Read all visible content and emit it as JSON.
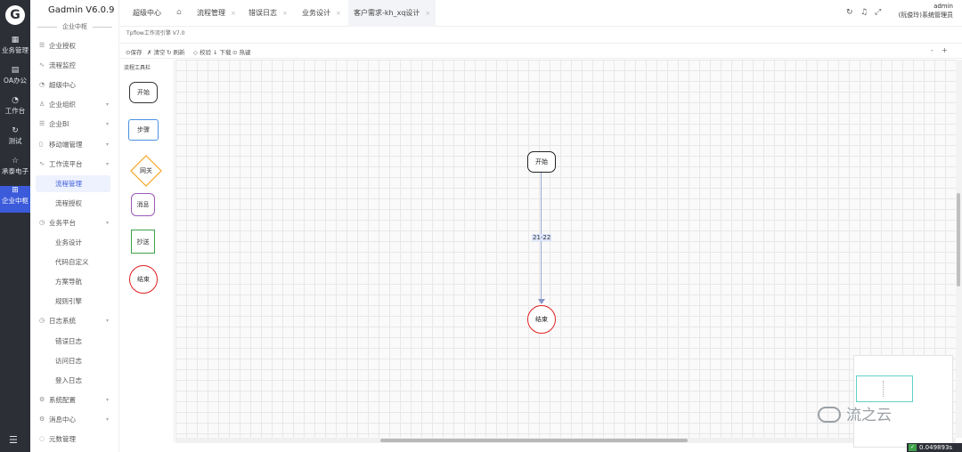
{
  "rail": {
    "logo": "G",
    "items": [
      {
        "icon": "grid-icon",
        "glyph": "▦",
        "label": "业务管理"
      },
      {
        "icon": "building-icon",
        "glyph": "▤",
        "label": "OA办公"
      },
      {
        "icon": "dashboard-icon",
        "glyph": "◔",
        "label": "工作台"
      },
      {
        "icon": "refresh-icon",
        "glyph": "↻",
        "label": "测试"
      },
      {
        "icon": "star-icon",
        "glyph": "☆",
        "label": "承泰电子"
      },
      {
        "icon": "apps-icon",
        "glyph": "⊞",
        "label": "企业中枢"
      }
    ],
    "menu_glyph": "☰"
  },
  "sidebar": {
    "brand": "Gadmin V6.0.9",
    "section": "企业中枢",
    "items": [
      {
        "glyph": "☰",
        "label": "企业授权",
        "chevron": false
      },
      {
        "glyph": "∿",
        "label": "流程监控",
        "chevron": false
      },
      {
        "glyph": "◔",
        "label": "超级中心",
        "chevron": false
      },
      {
        "glyph": "♙",
        "label": "企业组织",
        "chevron": true
      },
      {
        "glyph": "☰",
        "label": "企业BI",
        "chevron": true
      },
      {
        "glyph": "▯",
        "label": "移动端管理",
        "chevron": true
      },
      {
        "glyph": "∿",
        "label": "工作流平台",
        "chevron": true
      },
      {
        "glyph": "",
        "label": "流程管理",
        "sub": true
      },
      {
        "glyph": "",
        "label": "流程授权",
        "sub": true
      },
      {
        "glyph": "◷",
        "label": "业务平台",
        "chevron": true
      },
      {
        "glyph": "",
        "label": "业务设计",
        "sub": true
      },
      {
        "glyph": "",
        "label": "代码自定义",
        "sub": true
      },
      {
        "glyph": "",
        "label": "方案导航",
        "sub": true
      },
      {
        "glyph": "",
        "label": "规则引擎",
        "sub": true
      },
      {
        "glyph": "◷",
        "label": "日志系统",
        "chevron": true
      },
      {
        "glyph": "",
        "label": "错误日志",
        "sub": true
      },
      {
        "glyph": "",
        "label": "访问日志",
        "sub": true
      },
      {
        "glyph": "",
        "label": "登入日志",
        "sub": true
      },
      {
        "glyph": "⚙",
        "label": "系统配置",
        "chevron": true
      },
      {
        "glyph": "⚙",
        "label": "消息中心",
        "chevron": true
      },
      {
        "glyph": "◌",
        "label": "元数管理",
        "chevron": false
      }
    ]
  },
  "tabs": [
    {
      "label": "超级中心",
      "closable": false
    },
    {
      "label": "流程管理",
      "closable": true
    },
    {
      "label": "错误日志",
      "closable": true
    },
    {
      "label": "业务设计",
      "closable": true
    },
    {
      "label": "客户需求-kh_xq设计",
      "closable": true
    }
  ],
  "header": {
    "home_glyph": "⌂",
    "user_name": "admin",
    "user_role": "(阮俊玲)系统管理员",
    "close_glyph": "×"
  },
  "designer": {
    "version": "Tpflow工作流引擎 V7.0",
    "toolbar": {
      "save": "⊙保存",
      "clear": "✗ 清空",
      "refresh": "↻ 刷新",
      "check": "◇ 校验",
      "download": "↓ 下载",
      "hotkey": "⊙ 热键",
      "zoom_out": "-",
      "zoom_in": "+"
    },
    "palette_title": "流程工具栏",
    "palette": [
      {
        "label": "开始",
        "kind": "start"
      },
      {
        "label": "步骤",
        "kind": "step"
      },
      {
        "label": "网关",
        "kind": "gateway"
      },
      {
        "label": "消息",
        "kind": "message"
      },
      {
        "label": "抄送",
        "kind": "cc"
      },
      {
        "label": "结束",
        "kind": "end"
      }
    ],
    "canvas": {
      "start_label": "开始",
      "end_label": "结束",
      "edge_label": "21-22"
    }
  },
  "watermark": "流之云",
  "timer": "0.049893s",
  "colors": {
    "accent": "#3b5bdb",
    "rail": "#2c2f36",
    "end": "#e02020",
    "step": "#4a90e2",
    "gateway": "#f5a623",
    "message": "#9b59b6",
    "cc": "#3fa14a"
  }
}
